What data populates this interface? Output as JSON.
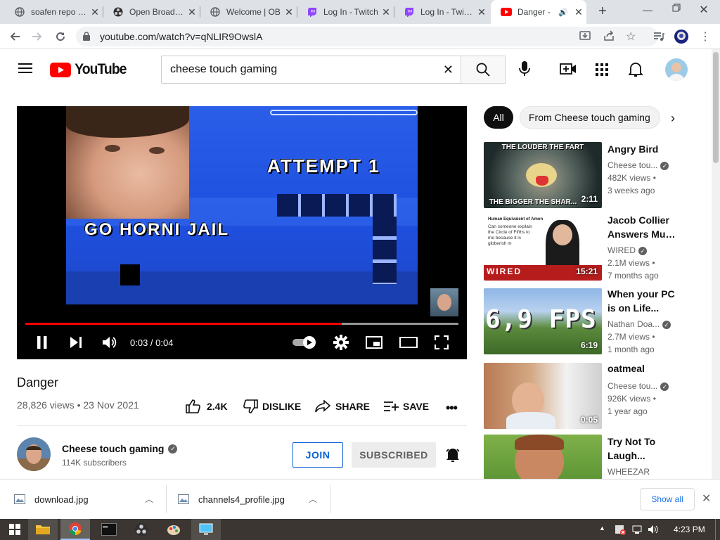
{
  "tabs": [
    {
      "title": "soafen repo / ...",
      "icon": "globe-icon"
    },
    {
      "title": "Open Broadcas",
      "icon": "obs-icon"
    },
    {
      "title": "Welcome | OB",
      "icon": "globe-icon"
    },
    {
      "title": "Log In - Twitch",
      "icon": "twitch-icon"
    },
    {
      "title": "Log In - Twitch",
      "icon": "twitch-icon"
    },
    {
      "title": "Danger -",
      "icon": "youtube-icon",
      "active": true
    }
  ],
  "browser": {
    "url": "youtube.com/watch?v=qNLIR9OwslA"
  },
  "yt": {
    "logo_text": "YouTube",
    "search_value": "cheese touch gaming"
  },
  "player": {
    "overlay_attempt": "ATTEMPT 1",
    "overlay_caption": "GO HORNI JAIL",
    "time": "0:03 / 0:04",
    "progress": 0.73
  },
  "video": {
    "title": "Danger",
    "stats": "28,826 views • 23 Nov 2021",
    "likes": "2.4K",
    "dislike_label": "DISLIKE",
    "share_label": "SHARE",
    "save_label": "SAVE"
  },
  "channel": {
    "name": "Cheese touch gaming",
    "subs": "114K subscribers",
    "join_label": "JOIN",
    "subscribed_label": "SUBSCRIBED"
  },
  "chips": [
    "All",
    "From Cheese touch gaming"
  ],
  "related": [
    {
      "title": "Angry Bird",
      "channel": "Cheese tou...",
      "verified": true,
      "views": "482K views •",
      "age": "3 weeks ago",
      "duration": "2:11",
      "thumb_top": "THE LOUDER THE FART",
      "thumb_bottom": "THE BIGGER THE SHAR..."
    },
    {
      "title": "Jacob Collier Answers Musi...",
      "title2": "Answers Musi...",
      "title1": "Jacob Collier",
      "channel": "WIRED",
      "verified": true,
      "views": "2.1M views •",
      "age": "7 months ago",
      "duration": "15:21",
      "thumb_top": "Human Equivalent of Amon",
      "thumb_text": "Can someone explain the Circle of Fifths to me because it is gibberish m",
      "thumb_bottom": "WIRED"
    },
    {
      "title1": "When your PC",
      "title2": "is on Life...",
      "channel": "Nathan Doa...",
      "verified": true,
      "views": "2.7M views •",
      "age": "1 month ago",
      "duration": "6:19",
      "thumb_text": "6,9 FPS"
    },
    {
      "title": "oatmeal",
      "channel": "Cheese tou...",
      "verified": true,
      "views": "926K views •",
      "age": "1 year ago",
      "duration": "0:05"
    },
    {
      "title1": "Try Not To",
      "title2": "Laugh...",
      "channel": "WHEEZAR"
    }
  ],
  "downloads": [
    {
      "name": "download.jpg"
    },
    {
      "name": "channels4_profile.jpg"
    }
  ],
  "download_show_all": "Show all",
  "taskbar": {
    "clock": "4:23 PM"
  }
}
